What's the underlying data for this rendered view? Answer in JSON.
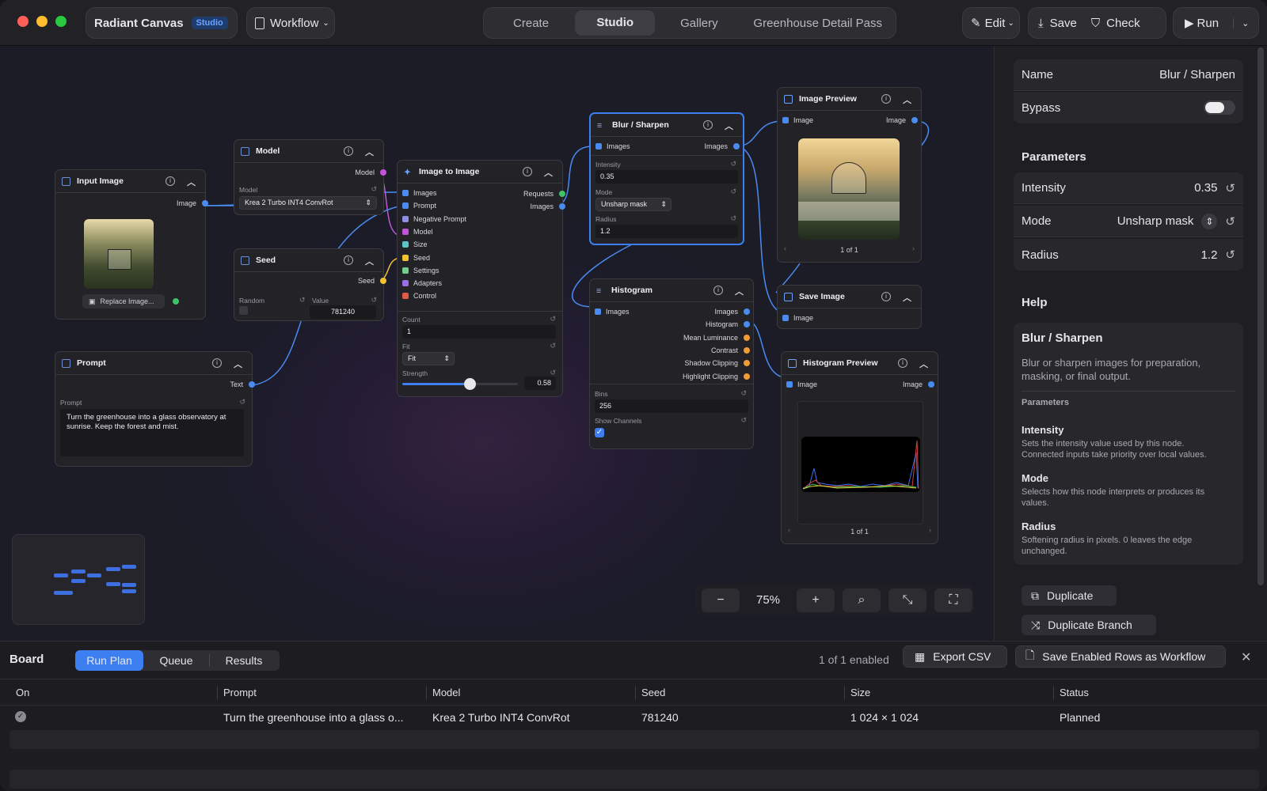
{
  "app": {
    "name": "Radiant Canvas",
    "badge": "Studio"
  },
  "toolbar": {
    "workflow_label": "Workflow",
    "tabs": [
      "Create",
      "Studio",
      "Gallery",
      "Greenhouse Detail Pass"
    ],
    "active_tab": "Studio",
    "edit_label": "Edit",
    "save_label": "Save",
    "check_label": "Check",
    "run_label": "Run"
  },
  "nodes": {
    "input_image": {
      "title": "Input Image",
      "port_out": "Image",
      "replace": "Replace Image..."
    },
    "model": {
      "title": "Model",
      "port_out": "Model",
      "field_label": "Model",
      "value": "Krea 2 Turbo INT4 ConvRot"
    },
    "seed": {
      "title": "Seed",
      "port_out": "Seed",
      "random_label": "Random",
      "value_label": "Value",
      "value": "781240"
    },
    "prompt": {
      "title": "Prompt",
      "port_out": "Text",
      "field_label": "Prompt",
      "text": "Turn the greenhouse into a glass observatory at sunrise. Keep the forest and mist."
    },
    "img2img": {
      "title": "Image to Image",
      "inputs": [
        "Images",
        "Prompt",
        "Negative Prompt",
        "Model",
        "Size",
        "Seed",
        "Settings",
        "Adapters",
        "Control"
      ],
      "out_requests": "Requests",
      "out_images": "Images",
      "count_label": "Count",
      "count": "1",
      "fit_label": "Fit",
      "fit": "Fit",
      "strength_label": "Strength",
      "strength": "0.58",
      "strength_fraction": 0.58
    },
    "blur": {
      "title": "Blur / Sharpen",
      "in": "Images",
      "out": "Images",
      "intensity_label": "Intensity",
      "intensity": "0.35",
      "mode_label": "Mode",
      "mode": "Unsharp mask",
      "radius_label": "Radius",
      "radius": "1.2"
    },
    "histogram": {
      "title": "Histogram",
      "in": "Images",
      "outputs": [
        "Images",
        "Histogram",
        "Mean Luminance",
        "Contrast",
        "Shadow Clipping",
        "Highlight Clipping"
      ],
      "bins_label": "Bins",
      "bins": "256",
      "channels_label": "Show Channels"
    },
    "preview": {
      "title": "Image Preview",
      "in": "Image",
      "out": "Image",
      "pager": "1 of 1"
    },
    "save": {
      "title": "Save Image",
      "in": "Image"
    },
    "hist_preview": {
      "title": "Histogram Preview",
      "in": "Image",
      "out": "Image",
      "pager": "1 of 1"
    }
  },
  "zoom": {
    "level": "75%"
  },
  "inspector": {
    "name_label": "Name",
    "name_value": "Blur / Sharpen",
    "bypass_label": "Bypass",
    "params_heading": "Parameters",
    "params": [
      {
        "label": "Intensity",
        "value": "0.35"
      },
      {
        "label": "Mode",
        "value": "Unsharp mask"
      },
      {
        "label": "Radius",
        "value": "1.2"
      }
    ],
    "help_heading": "Help",
    "help_title": "Blur / Sharpen",
    "help_desc": "Blur or sharpen images for preparation, masking, or final output.",
    "help_params_label": "Parameters",
    "help_items": [
      {
        "name": "Intensity",
        "desc": "Sets the intensity value used by this node. Connected inputs take priority over local values."
      },
      {
        "name": "Mode",
        "desc": "Selects how this node interprets or produces its values."
      },
      {
        "name": "Radius",
        "desc": "Softening radius in pixels. 0 leaves the edge unchanged."
      }
    ],
    "duplicate": "Duplicate",
    "duplicate_branch": "Duplicate Branch"
  },
  "board": {
    "title": "Board",
    "tabs": [
      "Run Plan",
      "Queue",
      "Results"
    ],
    "active_tab": "Run Plan",
    "enabled": "1 of 1 enabled",
    "export": "Export CSV",
    "save_rows": "Save Enabled Rows as Workflow",
    "columns": [
      "On",
      "Prompt",
      "Model",
      "Seed",
      "Size",
      "Status"
    ],
    "rows": [
      {
        "prompt": "Turn the greenhouse into a glass o...",
        "model": "Krea 2 Turbo INT4 ConvRot",
        "seed": "781240",
        "size": "1 024 × 1 024",
        "status": "Planned"
      }
    ]
  },
  "colors": {
    "accent": "#3d7ff0",
    "image_port": "#4a8bf0",
    "model_port": "#c254d6",
    "seed_port": "#f2c230",
    "request_port": "#3ec26a",
    "float_port": "#f29a38"
  }
}
